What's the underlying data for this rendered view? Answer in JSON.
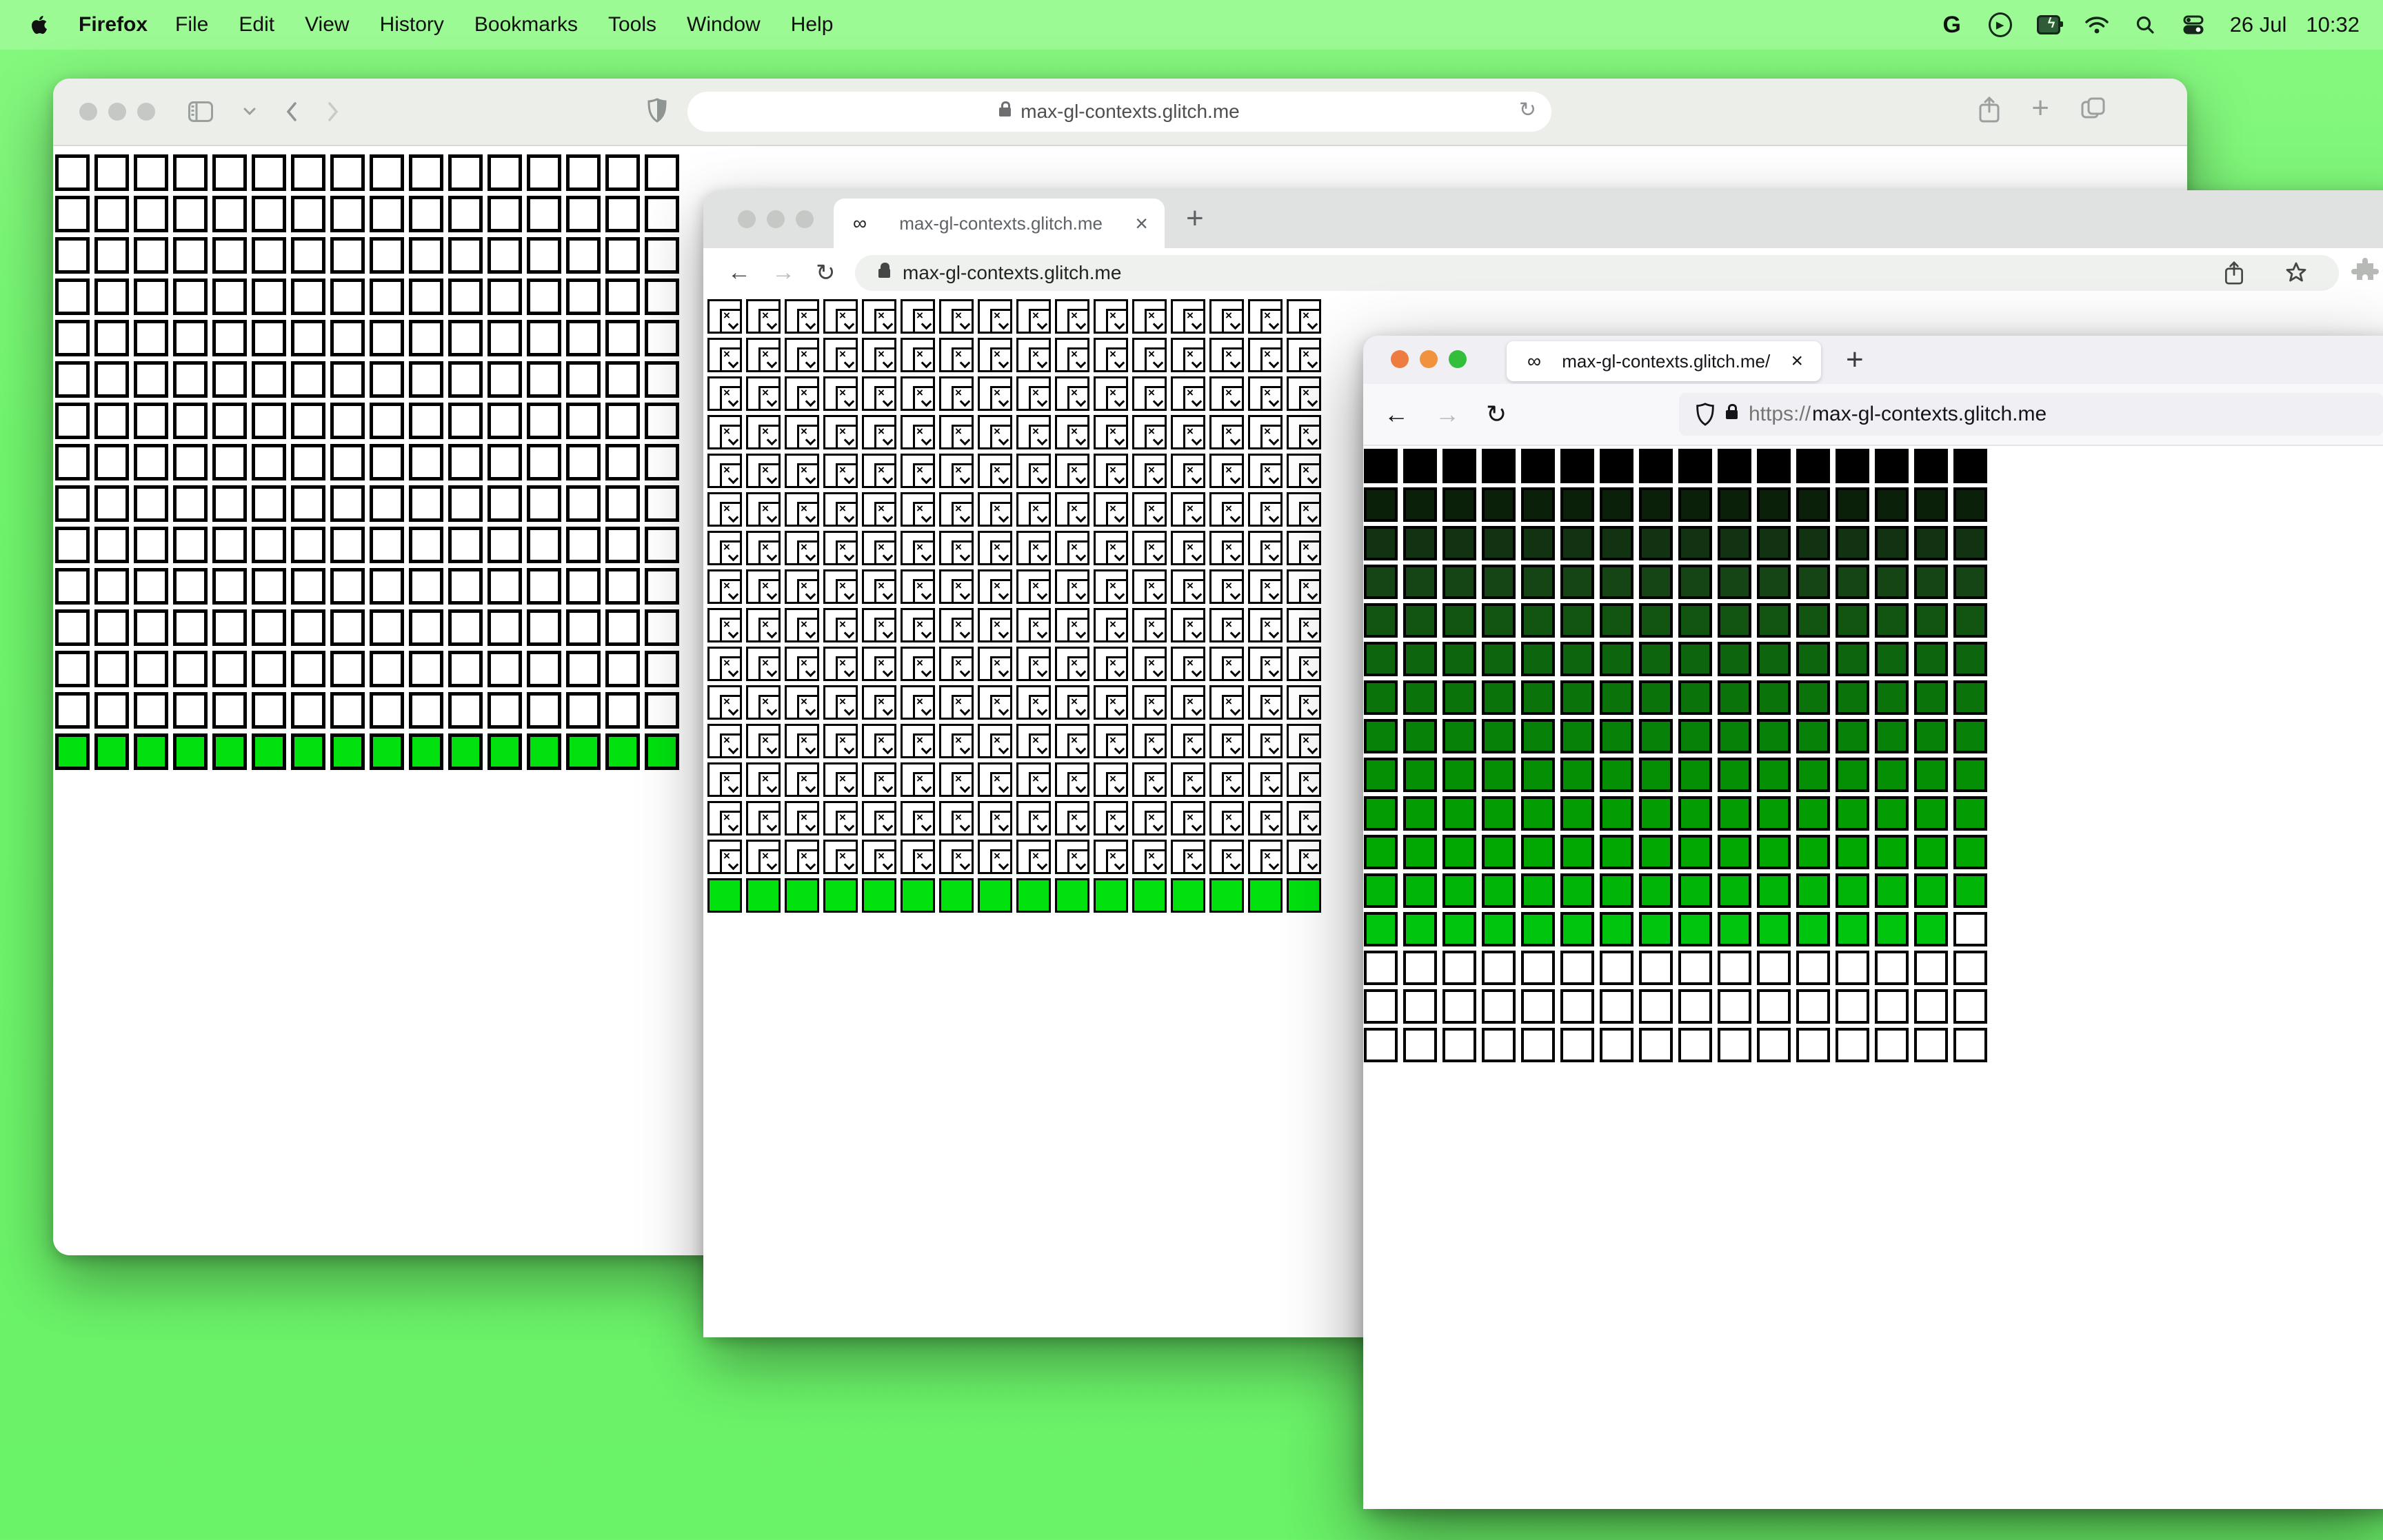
{
  "menu_bar": {
    "app_name": "Firefox",
    "menus": [
      "File",
      "Edit",
      "View",
      "History",
      "Bookmarks",
      "Tools",
      "Window",
      "Help"
    ],
    "google_label": "G",
    "date": "26 Jul",
    "time": "10:32"
  },
  "colors": {
    "desktop": "#70f56d",
    "menubar": "#9bfa93",
    "bright_green_row": "#00e10e",
    "inactive_traffic_light": "#c6c8c6",
    "firefox_traffic_lights": [
      "#ee7b40",
      "#f0923e",
      "#33bf3c"
    ]
  },
  "safari": {
    "url": "max-gl-contexts.glitch.me",
    "grid": {
      "columns": 16,
      "rows": 15,
      "white_rows": 14,
      "green_rows": 1,
      "cell_color": "#ffffff",
      "green_color": "#00e10e",
      "border_color": "#000000"
    }
  },
  "chrome": {
    "favicon": "∞",
    "tab_title": "max-gl-contexts.glitch.me",
    "url": "max-gl-contexts.glitch.me",
    "grid": {
      "columns": 16,
      "broken_image_rows": 15,
      "green_rows": 1,
      "green_color": "#00e10e",
      "border_color": "#000000"
    }
  },
  "firefox": {
    "favicon": "∞",
    "tab_title": "max-gl-contexts.glitch.me/",
    "url_scheme": "https://",
    "url_host": "max-gl-contexts.glitch.me",
    "grid": {
      "columns": 16,
      "rows": [
        {
          "color": "#000000"
        },
        {
          "color": "#0b2008"
        },
        {
          "color": "#113311"
        },
        {
          "color": "#154415"
        },
        {
          "color": "#115511"
        },
        {
          "color": "#0d650d"
        },
        {
          "color": "#0a730a"
        },
        {
          "color": "#078107"
        },
        {
          "color": "#058f05"
        },
        {
          "color": "#039c03"
        },
        {
          "color": "#02a802"
        },
        {
          "color": "#00b408"
        },
        {
          "color": "#00c50e",
          "white_cells_at_end": 1
        },
        {
          "color": "#ffffff"
        },
        {
          "color": "#ffffff"
        },
        {
          "color": "#ffffff"
        }
      ]
    }
  }
}
